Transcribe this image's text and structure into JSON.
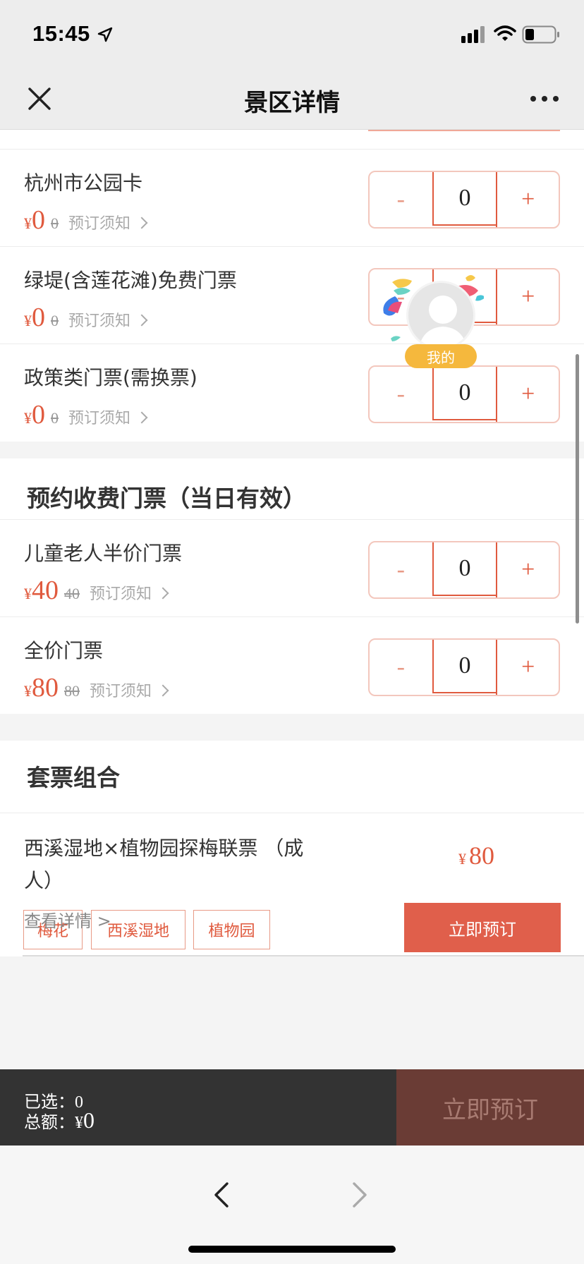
{
  "status_bar": {
    "time": "15:45"
  },
  "nav": {
    "title": "景区详情"
  },
  "free_tickets": [
    {
      "name": "杭州市公园卡",
      "yen": "¥",
      "price": "0",
      "original": "0",
      "notice": "预订须知",
      "qty": "0",
      "minus": "-",
      "plus": "+"
    },
    {
      "name": "绿堤(含莲花滩)免费门票",
      "yen": "¥",
      "price": "0",
      "original": "0",
      "notice": "预订须知",
      "qty": "0",
      "minus": "-",
      "plus": "+"
    },
    {
      "name": "政策类门票(需换票)",
      "yen": "¥",
      "price": "0",
      "original": "0",
      "notice": "预订须知",
      "qty": "0",
      "minus": "-",
      "plus": "+"
    }
  ],
  "paid_section": {
    "title": "预约收费门票（当日有效）",
    "tickets": [
      {
        "name": "儿童老人半价门票",
        "yen": "¥",
        "price": "40",
        "original": "40",
        "notice": "预订须知",
        "qty": "0",
        "minus": "-",
        "plus": "+"
      },
      {
        "name": "全价门票",
        "yen": "¥",
        "price": "80",
        "original": "80",
        "notice": "预订须知",
        "qty": "0",
        "minus": "-",
        "plus": "+"
      }
    ]
  },
  "package_section": {
    "title": "套票组合",
    "package": {
      "name": "西溪湿地×植物园探梅联票 （成人）",
      "tags": [
        "梅花",
        "西溪湿地",
        "植物园"
      ],
      "yen": "¥",
      "price": "80",
      "book_label": "立即预订",
      "detail_link": "查看详情 >"
    }
  },
  "float_button": {
    "label": "我的"
  },
  "bottom_bar": {
    "selected_label": "已选：",
    "selected_value": "0",
    "total_label": "总额：",
    "total_yen": "¥",
    "total_value": "0",
    "book_label": "立即预订"
  },
  "colors": {
    "accent": "#e05a3e",
    "book_button": "#e05f4b",
    "bottom_bar": "#333333",
    "bottom_book_disabled": "#6a3c35",
    "badge": "#f5b83d"
  }
}
